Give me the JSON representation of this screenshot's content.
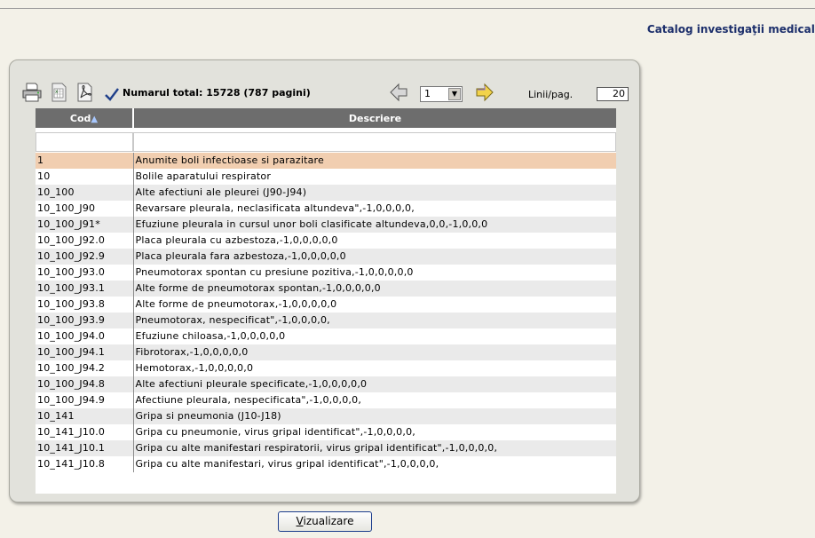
{
  "header": {
    "title": "Catalog investigaţii medicale"
  },
  "toolbar": {
    "total_text": "Numarul total: 15728 (787 pagini)",
    "page_value": "1",
    "lines_label": "Linii/pag.",
    "lines_value": "20",
    "icons": [
      "printer-icon",
      "export-excel-icon",
      "export-pdf-icon",
      "checkmark-icon",
      "prev-page-icon",
      "next-page-icon"
    ]
  },
  "grid": {
    "col_cod": "Cod",
    "col_desc": "Descriere",
    "rows": [
      {
        "cod": "1",
        "desc": "Anumite boli infectioase si parazitare"
      },
      {
        "cod": "10",
        "desc": "Bolile aparatului respirator"
      },
      {
        "cod": "10_100",
        "desc": "Alte afectiuni ale pleurei (J90-J94)"
      },
      {
        "cod": "10_100_J90",
        "desc": "Revarsare pleurala, neclasificata altundeva\",-1,0,0,0,0,"
      },
      {
        "cod": "10_100_J91*",
        "desc": "Efuziune pleurala in cursul unor boli clasificate altundeva,0,0,-1,0,0,0"
      },
      {
        "cod": "10_100_J92.0",
        "desc": "Placa pleurala cu azbestoza,-1,0,0,0,0,0"
      },
      {
        "cod": "10_100_J92.9",
        "desc": "Placa pleurala fara azbestoza,-1,0,0,0,0,0"
      },
      {
        "cod": "10_100_J93.0",
        "desc": "Pneumotorax spontan cu presiune pozitiva,-1,0,0,0,0,0"
      },
      {
        "cod": "10_100_J93.1",
        "desc": "Alte forme de pneumotorax spontan,-1,0,0,0,0,0"
      },
      {
        "cod": "10_100_J93.8",
        "desc": "Alte forme de pneumotorax,-1,0,0,0,0,0"
      },
      {
        "cod": "10_100_J93.9",
        "desc": "Pneumotorax, nespecificat\",-1,0,0,0,0,"
      },
      {
        "cod": "10_100_J94.0",
        "desc": "Efuziune chiloasa,-1,0,0,0,0,0"
      },
      {
        "cod": "10_100_J94.1",
        "desc": "Fibrotorax,-1,0,0,0,0,0"
      },
      {
        "cod": "10_100_J94.2",
        "desc": "Hemotorax,-1,0,0,0,0,0"
      },
      {
        "cod": "10_100_J94.8",
        "desc": "Alte afectiuni pleurale specificate,-1,0,0,0,0,0"
      },
      {
        "cod": "10_100_J94.9",
        "desc": "Afectiune pleurala, nespecificata\",-1,0,0,0,0,"
      },
      {
        "cod": "10_141",
        "desc": "Gripa si pneumonia (J10-J18)"
      },
      {
        "cod": "10_141_J10.0",
        "desc": "Gripa cu pneumonie, virus gripal identificat\",-1,0,0,0,0,"
      },
      {
        "cod": "10_141_J10.1",
        "desc": "Gripa cu alte manifestari respiratorii, virus gripal identificat\",-1,0,0,0,0,"
      },
      {
        "cod": "10_141_J10.8",
        "desc": "Gripa cu alte manifestari, virus gripal identificat\",-1,0,0,0,0,"
      }
    ]
  },
  "footer": {
    "button_prefix": "V",
    "button_rest": "izualizare"
  },
  "colors": {
    "header_bg": "#6d6d6d",
    "selected_row": "#f1ceb0",
    "title": "#1c2f6b"
  }
}
